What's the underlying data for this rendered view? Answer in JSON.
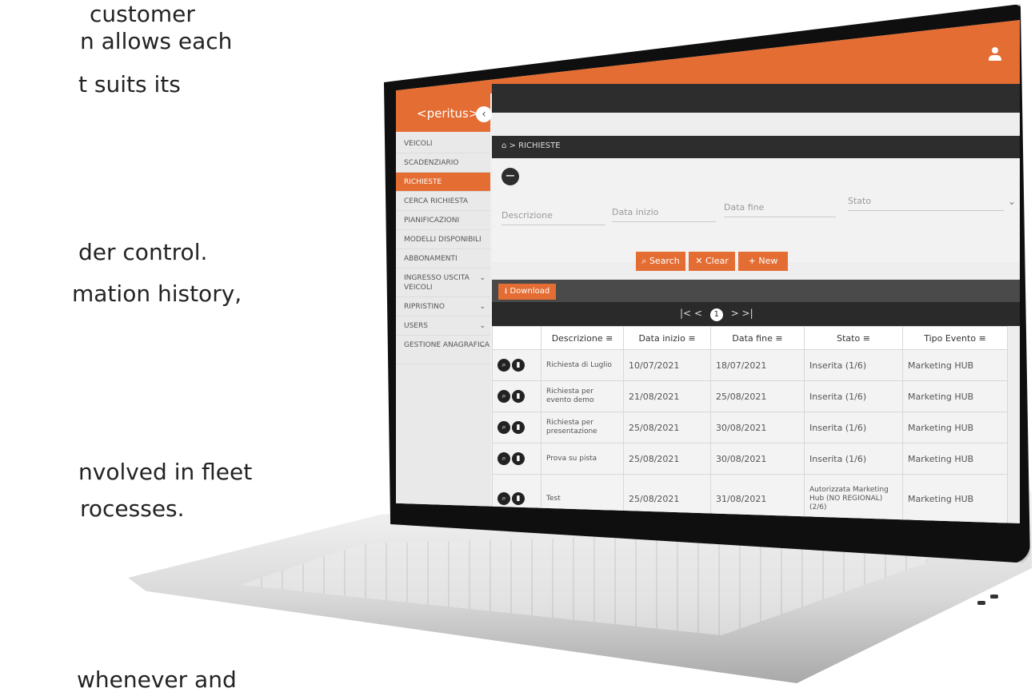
{
  "background_text": [
    "customer",
    "n allows each",
    "t suits its",
    "der control.",
    "mation history,",
    "nvolved in fleet",
    "rocesses.",
    "whenever and"
  ],
  "app": {
    "logo": "<peritus>",
    "collapse_icon": "chevron-left-icon",
    "user_icon": "user-icon"
  },
  "sidebar": {
    "items": [
      {
        "label": "VEICOLI"
      },
      {
        "label": "SCADENZIARIO"
      },
      {
        "label": "RICHIESTE",
        "active": true
      },
      {
        "label": "CERCA RICHIESTA"
      },
      {
        "label": "PIANIFICAZIONI"
      },
      {
        "label": "MODELLI DISPONIBILI"
      },
      {
        "label": "ABBONAMENTI"
      },
      {
        "label": "INGRESSO USCITA VEICOLI",
        "chevron": "chevron-down-icon"
      },
      {
        "label": "RIPRISTINO",
        "chevron": "chevron-down-icon"
      },
      {
        "label": "USERS",
        "chevron": "chevron-down-icon"
      },
      {
        "label": "GESTIONE ANAGRAFICA",
        "chevron": "chevron-down-icon"
      }
    ]
  },
  "breadcrumb": {
    "home_icon": "home-icon",
    "separator": ">",
    "current": "RICHIESTE"
  },
  "filters": {
    "toggle_label": "−",
    "description_placeholder": "Descrizione",
    "start_placeholder": "Data inizio",
    "end_placeholder": "Data fine",
    "status_placeholder": "Stato",
    "search_label": "Search",
    "clear_label": "Clear",
    "new_label": "New"
  },
  "toolbar": {
    "download_label": "Download"
  },
  "pager": {
    "first": "|<",
    "prev": "<",
    "current": "1",
    "next": ">",
    "last": ">|"
  },
  "table": {
    "columns": [
      "",
      "Descrizione",
      "Data inizio",
      "Data fine",
      "Stato",
      "Tipo Evento"
    ],
    "rows": [
      {
        "descrizione": "Richiesta di Luglio",
        "inizio": "10/07/2021",
        "fine": "18/07/2021",
        "stato": "Inserita (1/6)",
        "tipo": "Marketing HUB"
      },
      {
        "descrizione": "Richiesta per evento demo",
        "inizio": "21/08/2021",
        "fine": "25/08/2021",
        "stato": "Inserita (1/6)",
        "tipo": "Marketing HUB"
      },
      {
        "descrizione": "Richiesta per presentazione",
        "inizio": "25/08/2021",
        "fine": "30/08/2021",
        "stato": "Inserita (1/6)",
        "tipo": "Marketing HUB"
      },
      {
        "descrizione": "Prova su pista",
        "inizio": "25/08/2021",
        "fine": "30/08/2021",
        "stato": "Inserita (1/6)",
        "tipo": "Marketing HUB"
      },
      {
        "descrizione": "Test",
        "inizio": "25/08/2021",
        "fine": "31/08/2021",
        "stato": "Autorizzata Marketing Hub (NO REGIONAL) (2/6)",
        "tipo": "Marketing HUB"
      }
    ]
  },
  "colors": {
    "accent": "#e46d34",
    "dark": "#2d2d2d"
  }
}
